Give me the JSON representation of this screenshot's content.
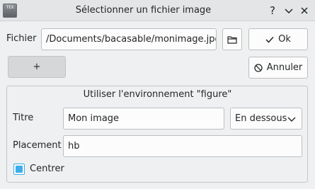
{
  "window": {
    "icon": "tex-app-icon",
    "icon_text": "TEX",
    "title": "Sélectionner un fichier image",
    "help_glyph": "?",
    "minimize_glyph": "⌄",
    "close_glyph": "✕"
  },
  "file": {
    "label": "Fichier",
    "value": "/Documents/bacasable/monimage.jpg",
    "browse_icon": "folder-icon"
  },
  "actions": {
    "ok_label": "Ok",
    "ok_icon": "check-icon",
    "add_label": "+",
    "cancel_label": "Annuler",
    "cancel_icon": "cancel-icon"
  },
  "figure": {
    "group_title": "Utiliser l'environnement \"figure\"",
    "title_label": "Titre",
    "title_value": "Mon image",
    "position_selected": "En dessous",
    "placement_label": "Placement",
    "placement_value": "hb",
    "center_label": "Centrer",
    "center_checked": true
  },
  "colors": {
    "accent": "#3daee9",
    "background": "#eff0f1"
  }
}
